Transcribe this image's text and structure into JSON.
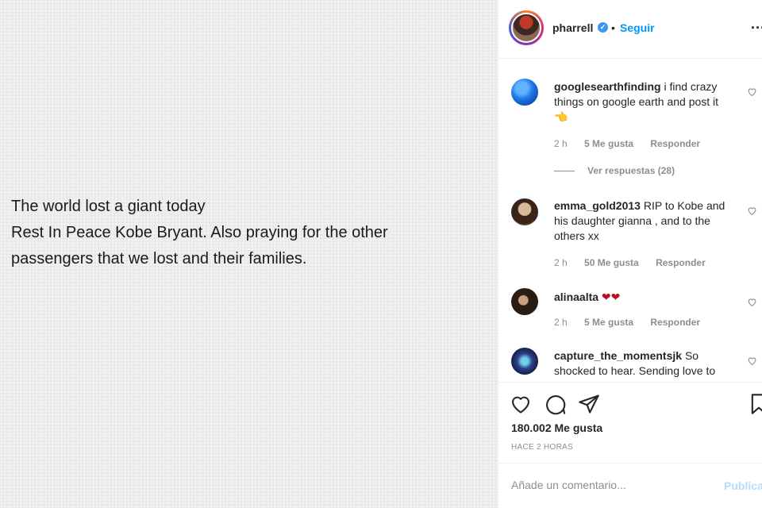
{
  "post": {
    "lines": [
      "The world lost a giant today",
      "Rest In Peace Kobe Bryant. Also praying for the other",
      "passengers that we lost and their families."
    ]
  },
  "header": {
    "username": "pharrell",
    "verified_icon": "verified-badge-icon",
    "separator": "•",
    "follow_label": "Seguir",
    "more_label": "..."
  },
  "comments": [
    {
      "username": "googlesearthfinding",
      "text": "i find crazy things on google earth and post it 👈",
      "time": "2 h",
      "likes": "5 Me gusta",
      "reply": "Responder",
      "view_replies": "Ver respuestas (28)"
    },
    {
      "username": "emma_gold2013",
      "text": "RIP to Kobe and his daughter gianna , and to the others xx",
      "time": "2 h",
      "likes": "50 Me gusta",
      "reply": "Responder"
    },
    {
      "username": "alinaalta",
      "text": "❤❤",
      "time": "2 h",
      "likes": "5 Me gusta",
      "reply": "Responder"
    },
    {
      "username": "capture_the_momentsjk",
      "text": "So shocked to hear. Sending love to"
    }
  ],
  "actions": {
    "like_count": "180.002 Me gusta",
    "time_ago": "HACE 2 HORAS"
  },
  "add_comment": {
    "placeholder": "Añade un comentario...",
    "publish_label": "Publicar"
  },
  "colors": {
    "accent": "#0095f6",
    "verified": "#3897f0",
    "muted": "#8e8e8e",
    "heart_red": "#b3121f"
  }
}
